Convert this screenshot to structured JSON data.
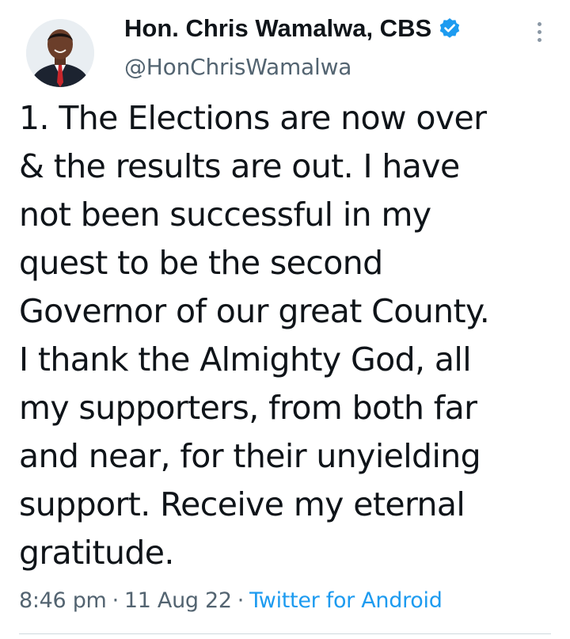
{
  "author": {
    "name": "Hon. Chris Wamalwa, CBS",
    "handle": "@HonChrisWamalwa",
    "verified": true,
    "avatar_icon": "profile-photo",
    "verified_icon": "verified-badge-icon"
  },
  "menu": {
    "icon": "more-vertical-icon"
  },
  "tweet": {
    "lines": [
      "1. The Elections are now over",
      "& the results are out. I have",
      "not been successful in my",
      "quest to be the second",
      "Governor of our great County.",
      "I thank the Almighty God, all",
      "my supporters, from both far",
      "and near, for their unyielding",
      "support. Receive my eternal",
      "gratitude."
    ]
  },
  "meta": {
    "time": "8:46 pm",
    "date": "11 Aug 22",
    "source": "Twitter for Android",
    "separator": "·"
  },
  "colors": {
    "text": "#0f1419",
    "secondary": "#536471",
    "accent": "#1d9bf0",
    "divider": "#cfd9de"
  }
}
